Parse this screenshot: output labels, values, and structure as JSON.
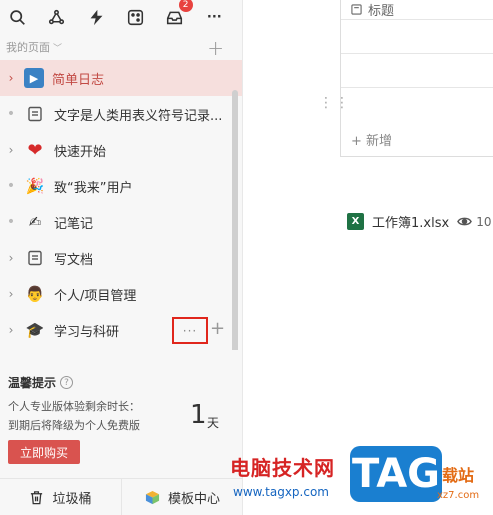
{
  "toolbar": {
    "icons": [
      "search-icon",
      "share-icon",
      "bolt-icon",
      "dice-icon",
      "inbox-icon",
      "more-icon"
    ],
    "inbox_badge": "2",
    "more_label": "···"
  },
  "sidebar": {
    "section_title": "我的页面",
    "section_chevron": "﹀",
    "add_label": "+",
    "items": [
      {
        "label": "简单日志",
        "emoji": "▶",
        "has_arrow": true,
        "active": true
      },
      {
        "label": "文字是人类用表义符号记录...",
        "emoji": "▤",
        "has_arrow": false
      },
      {
        "label": "快速开始",
        "emoji": "❤",
        "has_arrow": true
      },
      {
        "label": "致“我来”用户",
        "emoji": "🎉",
        "has_arrow": false
      },
      {
        "label": "记笔记",
        "emoji": "✍",
        "has_arrow": false
      },
      {
        "label": "写文档",
        "emoji": "▤",
        "has_arrow": true
      },
      {
        "label": "个人/项目管理",
        "emoji": "👨",
        "has_arrow": true
      },
      {
        "label": "学习与科研",
        "emoji": "🎓",
        "has_arrow": true
      }
    ],
    "item_more": "···",
    "item_plus": "+"
  },
  "tips": {
    "title": "温馨提示",
    "line1": "个人专业版体验剩余时长：",
    "line2": "到期后将降级为个人免费版",
    "days_value": "1",
    "days_unit": "天",
    "buy_button": "立即购买"
  },
  "footer": {
    "trash": "垃圾桶",
    "templates": "模板中心"
  },
  "table": {
    "header": "标题",
    "add_row": "+ 新增"
  },
  "file": {
    "name": "工作簿1.xlsx",
    "views": "10"
  },
  "watermark": {
    "text": "电脑技术网",
    "url": "www.tagxp.com",
    "tag": "TAG",
    "xz": "载站",
    "site": "xz7.com"
  },
  "colors": {
    "active_bg": "#f6dfdd",
    "active_text": "#c24a44",
    "buy_button": "#d9534f",
    "highlight_box": "#e0261c"
  }
}
